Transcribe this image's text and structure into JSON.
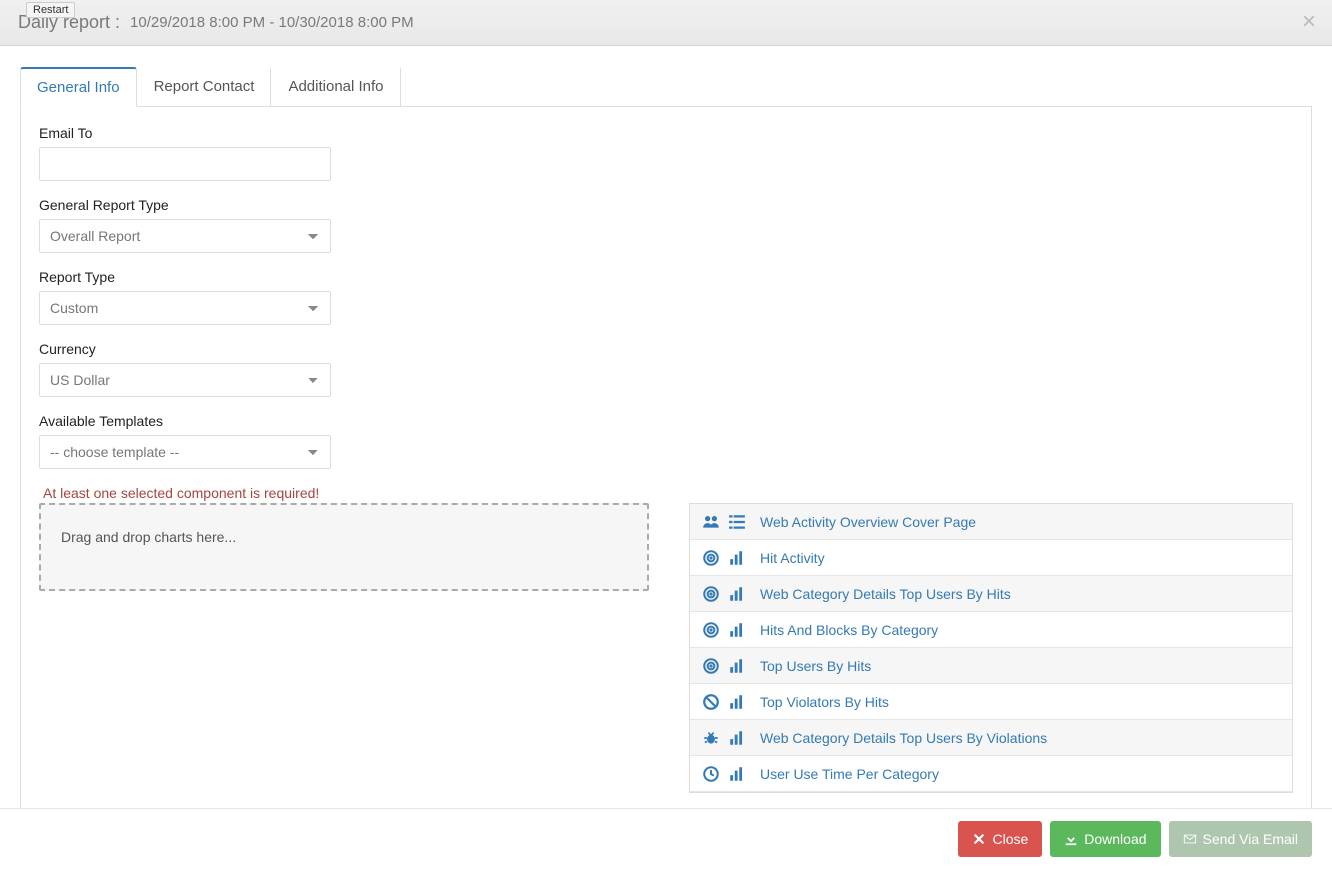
{
  "restart_label": "Restart",
  "header": {
    "title": "Daily report :",
    "range": "10/29/2018 8:00 PM - 10/30/2018 8:00 PM"
  },
  "tabs": {
    "general": "General Info",
    "contact": "Report Contact",
    "additional": "Additional Info"
  },
  "form": {
    "email_label": "Email To",
    "email_value": "",
    "general_type_label": "General Report Type",
    "general_type_value": "Overall Report",
    "report_type_label": "Report Type",
    "report_type_value": "Custom",
    "currency_label": "Currency",
    "currency_value": "US Dollar",
    "templates_label": "Available Templates",
    "templates_value": "-- choose template --"
  },
  "error": "At least one selected component is required!",
  "dropzone": "Drag and drop charts here...",
  "templates": [
    {
      "icon1": "users",
      "icon2": "list",
      "label": "Web Activity Overview Cover Page"
    },
    {
      "icon1": "target",
      "icon2": "bars",
      "label": "Hit Activity"
    },
    {
      "icon1": "target",
      "icon2": "bars",
      "label": "Web Category Details Top Users By Hits"
    },
    {
      "icon1": "target",
      "icon2": "bars",
      "label": "Hits And Blocks By Category"
    },
    {
      "icon1": "target",
      "icon2": "bars",
      "label": "Top Users By Hits"
    },
    {
      "icon1": "ban",
      "icon2": "bars",
      "label": "Top Violators By Hits"
    },
    {
      "icon1": "bug",
      "icon2": "bars",
      "label": "Web Category Details Top Users By Violations"
    },
    {
      "icon1": "clock",
      "icon2": "bars",
      "label": "User Use Time Per Category"
    }
  ],
  "footer": {
    "close": "Close",
    "download": "Download",
    "send": "Send Via Email"
  }
}
